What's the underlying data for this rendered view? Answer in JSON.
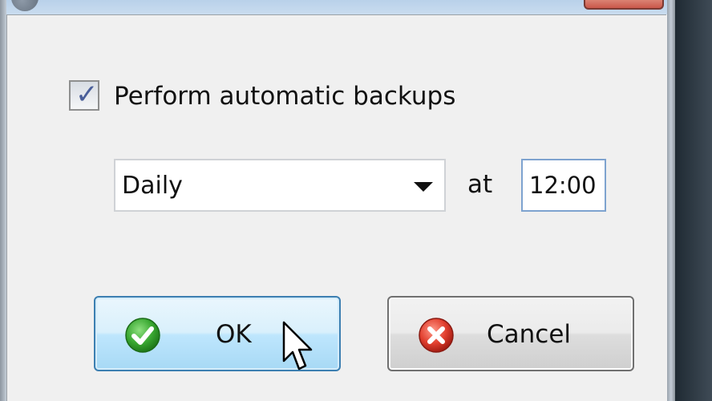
{
  "dialog": {
    "auto_backup_checkbox": {
      "label": "Perform automatic backups",
      "checked": true
    },
    "frequency": {
      "selected": "Daily"
    },
    "at_label": "at",
    "time": {
      "value": "12:00"
    },
    "buttons": {
      "ok_label": "OK",
      "cancel_label": "Cancel"
    }
  },
  "icons": {
    "ok": "check-circle-icon",
    "cancel": "x-circle-icon",
    "dropdown": "chevron-down-icon",
    "cursor": "mouse-pointer-icon"
  },
  "colors": {
    "ok_icon": "#2f9a2a",
    "cancel_icon": "#d8352a",
    "ok_button_border": "#3c7fb1",
    "focus_border": "#7ea3cf"
  }
}
